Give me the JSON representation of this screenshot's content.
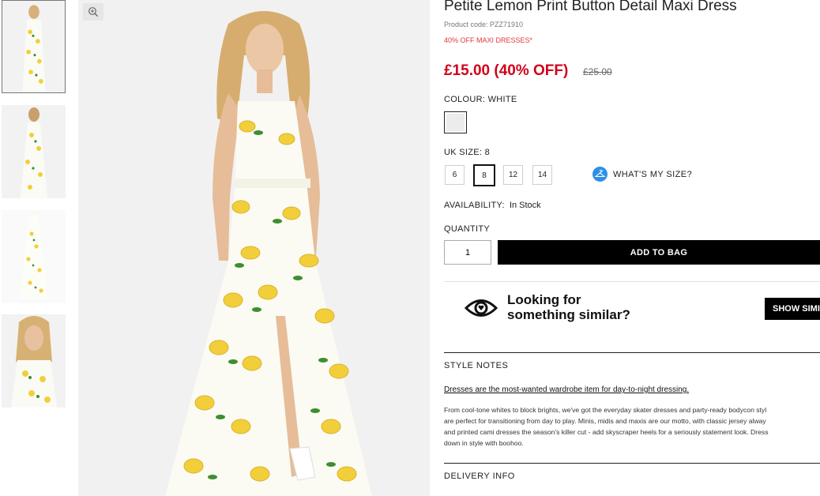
{
  "product": {
    "title": "Petite Lemon Print Button Detail Maxi Dress",
    "code": "Product code: PZZ71910",
    "promo": "40% OFF MAXI DRESSES*",
    "price": "£15.00 (40% OFF)",
    "old_price": "£25.00"
  },
  "colour": {
    "label": "COLOUR:",
    "value": "WHITE",
    "swatch_color": "#ececec"
  },
  "size": {
    "label": "UK SIZE:",
    "value": "8",
    "options": [
      "6",
      "8",
      "12",
      "14"
    ],
    "selected": "8",
    "whats_my_size": "WHAT'S MY SIZE?"
  },
  "availability": {
    "label": "AVAILABILITY:",
    "value": "In Stock"
  },
  "quantity": {
    "label": "QUANTITY",
    "value": "1"
  },
  "add_to_bag": "ADD TO BAG",
  "similar": {
    "line1": "Looking for",
    "line2": "something similar?",
    "button": "SHOW SIMI"
  },
  "style_notes": {
    "heading": "STYLE NOTES",
    "link": "Dresses are the most-wanted wardrobe item for day-to-night dressing.",
    "body": [
      "From cool-tone whites to block brights, we've got the everyday skater dresses and party-ready bodycon styl",
      "are perfect for transitioning from day to play. Minis, midis and maxis are our motto, with classic jersey alway",
      "and printed cami dresses the season's killer cut - add skyscraper heels for a seriously statement look. Dress",
      "down in style with boohoo."
    ]
  },
  "delivery": {
    "heading": "DELIVERY INFO"
  },
  "colors": {
    "price_red": "#d0021b",
    "promo_red": "#e03a3a",
    "info_blue": "#2f8fe6",
    "lemon": "#f2cf3a",
    "leaf": "#3e8e2f"
  },
  "icons": {
    "zoom": "zoom-in-icon",
    "size_guide": "hanger-icon",
    "similar": "eye-icon"
  }
}
